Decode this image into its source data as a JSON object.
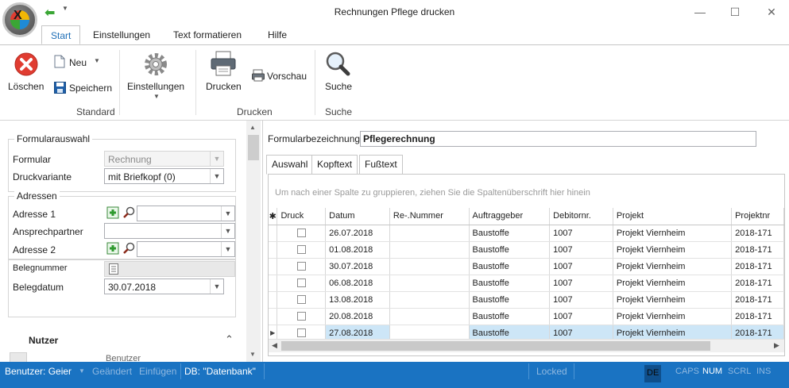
{
  "window": {
    "title": "Rechnungen Pflege drucken",
    "minimize": "—",
    "maximize": "☐",
    "close": "✕"
  },
  "ribbon_tabs": [
    {
      "label": "Start",
      "active": true
    },
    {
      "label": "Einstellungen",
      "active": false
    },
    {
      "label": "Text formatieren",
      "active": false
    },
    {
      "label": "Hilfe",
      "active": false
    }
  ],
  "ribbon": {
    "loeschen": "Löschen",
    "neu": "Neu",
    "speichern": "Speichern",
    "einstellungen": "Einstellungen",
    "drucken": "Drucken",
    "vorschau": "Vorschau",
    "suche": "Suche",
    "groups": {
      "standard": "Standard",
      "drucken": "Drucken",
      "suche": "Suche"
    }
  },
  "left": {
    "formularauswahl": {
      "legend": "Formularauswahl",
      "formular_label": "Formular",
      "formular_value": "Rechnung",
      "druckvariante_label": "Druckvariante",
      "druckvariante_value": "mit Briefkopf (0)"
    },
    "adressen": {
      "legend": "Adressen",
      "adresse1_label": "Adresse 1",
      "ansprechpartner_label": "Ansprechpartner",
      "adresse2_label": "Adresse 2"
    },
    "beleg": {
      "belegnummer_label": "Belegnummer",
      "belegdatum_label": "Belegdatum",
      "belegdatum_value": "30.07.2018"
    },
    "nutzer": {
      "header": "Nutzer",
      "partial_value": "Benutzer"
    }
  },
  "right": {
    "formularbezeichnung_label": "Formularbezeichnung",
    "formularbezeichnung_value": "Pflegerechnung",
    "tabs": [
      "Auswahl",
      "Kopftext",
      "Fußtext"
    ],
    "group_hint": "Um nach einer Spalte zu gruppieren, ziehen Sie die Spaltenüberschrift hier hinein",
    "columns": [
      "Druck",
      "Datum",
      "Re-.Nummer",
      "Auftraggeber",
      "Debitornr.",
      "Projekt",
      "Projektnr"
    ],
    "rows": [
      {
        "datum": "26.07.2018",
        "renr": "",
        "auftraggeber": "Baustoffe",
        "debitor": "1007",
        "projekt": "Projekt Viernheim",
        "projektnr": "2018-171"
      },
      {
        "datum": "01.08.2018",
        "renr": "",
        "auftraggeber": "Baustoffe",
        "debitor": "1007",
        "projekt": "Projekt Viernheim",
        "projektnr": "2018-171"
      },
      {
        "datum": "30.07.2018",
        "renr": "",
        "auftraggeber": "Baustoffe",
        "debitor": "1007",
        "projekt": "Projekt Viernheim",
        "projektnr": "2018-171"
      },
      {
        "datum": "06.08.2018",
        "renr": "",
        "auftraggeber": "Baustoffe",
        "debitor": "1007",
        "projekt": "Projekt Viernheim",
        "projektnr": "2018-171"
      },
      {
        "datum": "13.08.2018",
        "renr": "",
        "auftraggeber": "Baustoffe",
        "debitor": "1007",
        "projekt": "Projekt Viernheim",
        "projektnr": "2018-171"
      },
      {
        "datum": "20.08.2018",
        "renr": "",
        "auftraggeber": "Baustoffe",
        "debitor": "1007",
        "projekt": "Projekt Viernheim",
        "projektnr": "2018-171"
      },
      {
        "datum": "27.08.2018",
        "renr": "",
        "auftraggeber": "Baustoffe",
        "debitor": "1007",
        "projekt": "Projekt Viernheim",
        "projektnr": "2018-171"
      }
    ],
    "selected_row": 6
  },
  "status": {
    "benutzer": "Benutzer: Geier",
    "geaendert": "Geändert",
    "einfuegen": "Einfügen",
    "db": "DB: \"Datenbank\"",
    "locked": "Locked",
    "lang": "DE",
    "caps": "CAPS",
    "num": "NUM",
    "scrl": "SCRL",
    "ins": "INS"
  },
  "colors": {
    "accent": "#1f6fb7",
    "statusbar": "#1a73c2",
    "selected_row": "#cde6f7"
  }
}
